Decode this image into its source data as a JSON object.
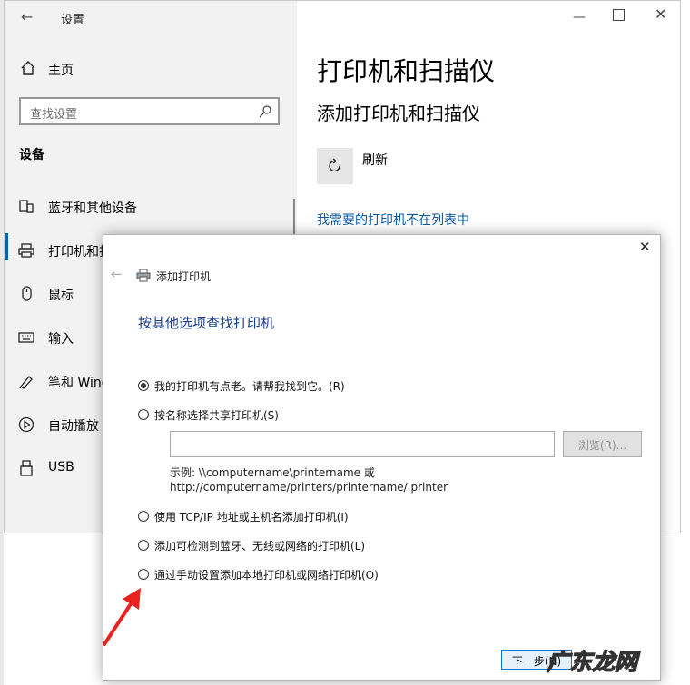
{
  "settings": {
    "title": "设置",
    "home": "主页",
    "search_placeholder": "查找设置",
    "section_heading": "设备",
    "nav": [
      {
        "label": "蓝牙和其他设备",
        "icon": "bluetooth-devices-icon"
      },
      {
        "label": "打印机和扫描仪",
        "icon": "printer-icon",
        "selected": true
      },
      {
        "label": "鼠标",
        "icon": "mouse-icon"
      },
      {
        "label": "输入",
        "icon": "keyboard-icon"
      },
      {
        "label": "笔和 Windows Ink",
        "icon": "pen-icon"
      },
      {
        "label": "自动播放",
        "icon": "autoplay-icon"
      },
      {
        "label": "USB",
        "icon": "usb-icon"
      }
    ],
    "main": {
      "title": "打印机和扫描仪",
      "subtitle": "添加打印机和扫描仪",
      "refresh_label": "刷新",
      "missing_link": "我需要的打印机不在列表中"
    }
  },
  "dialog": {
    "title": "添加打印机",
    "heading": "按其他选项查找打印机",
    "options": [
      {
        "label": "我的打印机有点老。请帮我找到它。(R)",
        "selected": true
      },
      {
        "label": "按名称选择共享打印机(S)",
        "selected": false
      },
      {
        "label": "使用 TCP/IP 地址或主机名添加打印机(I)",
        "selected": false
      },
      {
        "label": "添加可检测到蓝牙、无线或网络的打印机(L)",
        "selected": false
      },
      {
        "label": "通过手动设置添加本地打印机或网络打印机(O)",
        "selected": false
      }
    ],
    "share_input_value": "",
    "browse_label": "浏览(R)...",
    "example_line1": "示例: \\\\computername\\printername 或",
    "example_line2": "http://computername/printers/printername/.printer",
    "next_label": "下一步(N)"
  },
  "watermark": "广东龙网",
  "colors": {
    "accent": "#0063b1",
    "link": "#0a57a3",
    "heading": "#1a3e8c",
    "arrow": "#e8231f"
  }
}
